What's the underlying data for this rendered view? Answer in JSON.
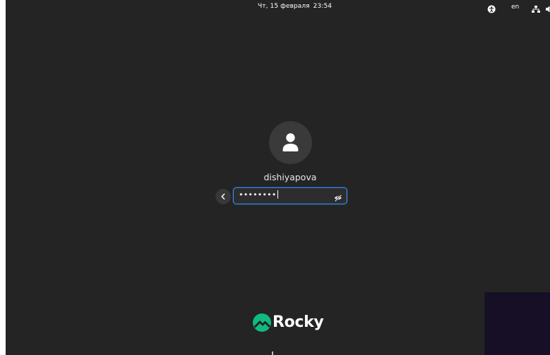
{
  "topbar": {
    "date": "Чт, 15 февраля",
    "time": "23:54",
    "language": "en",
    "icons": {
      "accessibility": "accessibility-icon",
      "network": "network-icon",
      "volume": "volume-icon"
    }
  },
  "login": {
    "avatar_icon": "user-avatar-icon",
    "username": "dishiyapova",
    "password_masked": "••••••••",
    "back_icon": "chevron-left-icon",
    "reveal_icon": "eye-crossed-icon"
  },
  "branding": {
    "logo_text": "Rocky",
    "logo_color": "#10b981"
  },
  "colors": {
    "background": "#242424",
    "accent": "#3584e4"
  }
}
